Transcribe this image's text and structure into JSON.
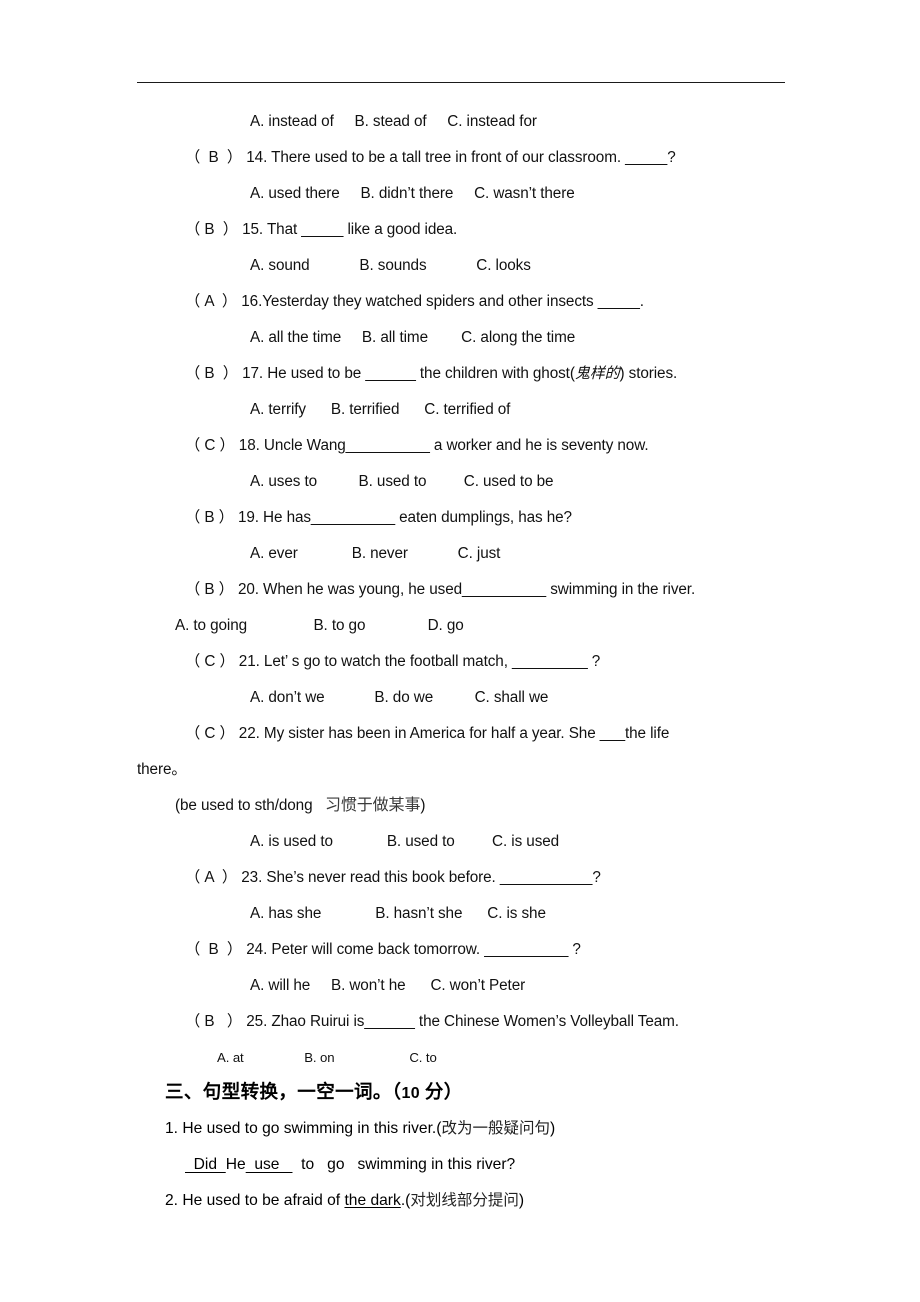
{
  "page": {
    "header_rule": true
  },
  "questions": [
    {
      "options_only": true,
      "options": "A. instead of     B. stead of     C. instead for"
    },
    {
      "answer": "（  B  ）",
      "text": " 14. There used to be a tall tree in front of our classroom. _____?",
      "options": "A. used there     B. didn’t there     C. wasn’t there"
    },
    {
      "answer": "（ B  ）",
      "text": " 15. That _____ like a good idea.",
      "options": "A. sound            B. sounds            C. looks"
    },
    {
      "answer": "（ A  ）",
      "text": " 16.Yesterday they watched spiders and other insects _____.",
      "options": "A. all the time     B. all time        C. along the time"
    },
    {
      "answer": "（ B  ）",
      "text_pre": " 17. He used to be ______ the children with ghost(",
      "text_cn": "鬼样的",
      "text_post": ") stories.",
      "options": "A. terrify      B. terrified      C. terrified of"
    },
    {
      "answer": "（ C ）",
      "text": " 18. Uncle Wang__________ a worker and he is seventy now.",
      "options": "A. uses to          B. used to         C. used to be"
    },
    {
      "answer": "（ B ）",
      "text": " 19. He has__________ eaten dumplings, has he?",
      "options": "A. ever             B. never            C. just"
    },
    {
      "answer": "（ B ）",
      "text": " 20. When he was young, he used__________ swimming in the river.",
      "options_flush": "A. to going                B. to go               D. go"
    },
    {
      "answer": "（ C ）",
      "text": " 21. Let’ s go to watch the football match, _________ ?",
      "options": "A. don’t we            B. do we          C. shall we"
    },
    {
      "answer": "（ C ）",
      "text": " 22. My sister has been in America for half a year. She ___the life",
      "wrap": "there。",
      "note_pre": "(be used to sth/dong   ",
      "note_cn": "习惯于做某事",
      "note_post": ")",
      "options": "A. is used to             B. used to         C. is used"
    },
    {
      "answer": "（ A  ）",
      "text": " 23. She’s never read this book before. ___________?",
      "options": "A. has she             B. hasn’t she      C. is she"
    },
    {
      "answer": "（  B  ）",
      "text": " 24. Peter will come back tomorrow. __________ ?",
      "options": "A. will he     B. won’t he      C. won’t Peter"
    },
    {
      "answer": "（ B   ）",
      "text": " 25. Zhao Ruirui is______ the Chinese Women’s Volleyball Team.",
      "options_small": "A. at                 B. on                     C. to"
    }
  ],
  "section_three": {
    "heading_cn": "三、句型转换，一空一词。（",
    "heading_points": "10 ",
    "heading_cn_tail": "分）",
    "item1": {
      "text_en": "1. He used to go swimming in this river.(",
      "text_cn": "改为一般疑问句",
      "text_close": ")",
      "answer_blank1": "  Did  ",
      "answer_mid1": "He",
      "answer_blank2": "  use   ",
      "answer_tail": "  to   go   swimming in this river?"
    },
    "item2": {
      "text_pre": "2. He used to be afraid of ",
      "underlined": "the dark",
      "text_mid": ".(",
      "text_cn": "对划线部分提问",
      "text_close": ")"
    }
  }
}
